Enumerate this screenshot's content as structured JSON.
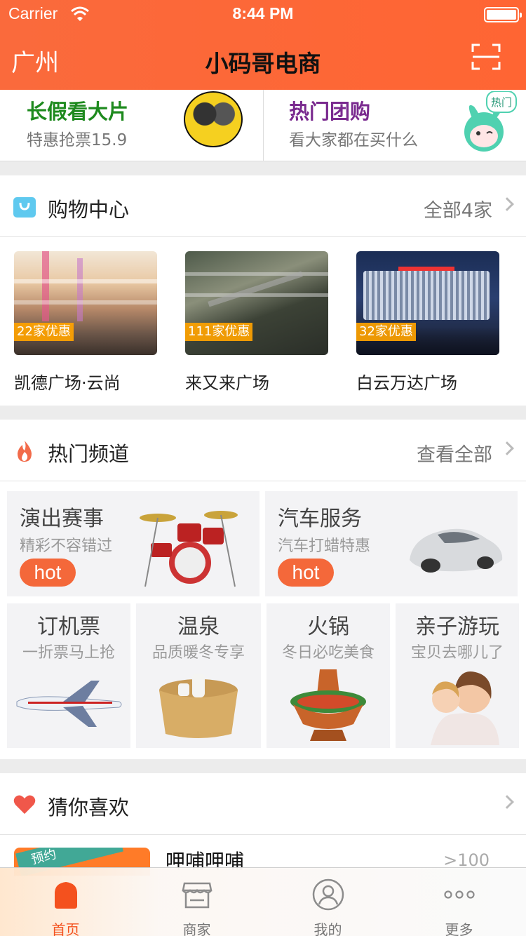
{
  "status_bar": {
    "carrier": "Carrier",
    "time": "8:44 PM"
  },
  "nav": {
    "city": "广州",
    "title": "小码哥电商",
    "scan_icon": "scan-icon"
  },
  "promos": [
    {
      "title": "长假看大片",
      "subtitle": "特惠抢票15.9"
    },
    {
      "title": "热门团购",
      "subtitle": "看大家都在买什么",
      "mascot_text": "热门"
    }
  ],
  "shopping": {
    "title": "购物中心",
    "more": "全部4家",
    "icon": "shopping-bag-icon",
    "malls": [
      {
        "name": "凯德广场·云尚",
        "badge": "22家优惠"
      },
      {
        "name": "来又来广场",
        "badge": "111家优惠"
      },
      {
        "name": "白云万达广场",
        "badge": "32家优惠"
      }
    ]
  },
  "hot_channels": {
    "title": "热门频道",
    "more": "查看全部",
    "icon": "flame-icon",
    "big": [
      {
        "title": "演出赛事",
        "subtitle": "精彩不容错过",
        "tag": "hot"
      },
      {
        "title": "汽车服务",
        "subtitle": "汽车打蜡特惠",
        "tag": "hot"
      }
    ],
    "small": [
      {
        "title": "订机票",
        "subtitle": "一折票马上抢"
      },
      {
        "title": "温泉",
        "subtitle": "品质暖冬专享"
      },
      {
        "title": "火锅",
        "subtitle": "冬日必吃美食"
      },
      {
        "title": "亲子游玩",
        "subtitle": "宝贝去哪儿了"
      }
    ]
  },
  "guess": {
    "title": "猜你喜欢",
    "icon": "heart-icon",
    "first_item": {
      "name": "呷哺呷哺",
      "count": ">100",
      "ribbon": "预约"
    }
  },
  "tabbar": {
    "active": 0,
    "tabs": [
      {
        "label": "首页",
        "icon": "home-icon"
      },
      {
        "label": "商家",
        "icon": "shop-icon"
      },
      {
        "label": "我的",
        "icon": "profile-icon"
      },
      {
        "label": "更多",
        "icon": "more-icon"
      }
    ]
  },
  "colors": {
    "brand": "#ff6533",
    "hot": "#f4683a",
    "badge": "#ffa300"
  }
}
